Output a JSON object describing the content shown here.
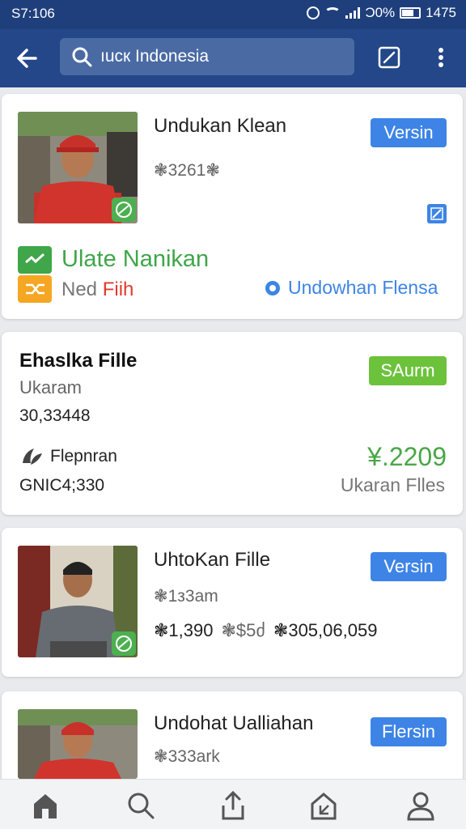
{
  "status_bar": {
    "time": "S7:106",
    "battery_text": "Ɔ0%",
    "right_text": "1475"
  },
  "app_bar": {
    "search_text": "ıucк Indonesia"
  },
  "cards": [
    {
      "title": "Undukan Klean",
      "meta": "❃3261❃",
      "chip": "Versin",
      "status_label": "Ulate Nanikan",
      "secondary_label_a": "Ned",
      "secondary_label_b": "Fiih",
      "action_link": "Undowhan Flensa"
    },
    {
      "title": "Ehaslka Fille",
      "subtitle": "Ukaram",
      "number": "30,33448",
      "chip": "SAurm",
      "brand_label": "Flepnran",
      "code": "GNIC4;330",
      "price": "¥.2209",
      "files_label": "Ukaran Flles"
    },
    {
      "title": "UhtoKan Fille",
      "meta": "❃1з3am",
      "stats": [
        "❃1,390",
        "❃$5ძ",
        "❃305,06,059"
      ],
      "chip": "Versin"
    },
    {
      "title": "Undohat Ualliahan",
      "meta": "❃333ark",
      "chip": "Flersin"
    }
  ],
  "colors": {
    "app_bar": "#234788",
    "accent_blue": "#3d84e6",
    "accent_green": "#6dc23c",
    "status_green": "#3fa64a",
    "price_green": "#4aa648",
    "badge_orange": "#f5a623",
    "red_text": "#e03a2e"
  }
}
